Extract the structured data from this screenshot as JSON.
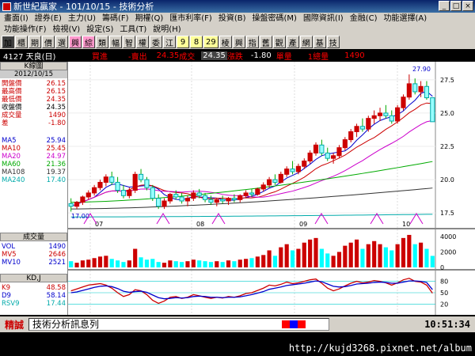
{
  "window": {
    "title": "新世紀贏家 - 101/10/15 - 技術分析"
  },
  "menu": {
    "row1": [
      "畫面(I)",
      "證券(E)",
      "主力(U)",
      "籌碼(F)",
      "期權(Q)",
      "匯市利率(F)",
      "投資(B)",
      "操盤密碼(M)",
      "國際資訊(I)",
      "金融(C)",
      "功能選擇(A)",
      "功能操作(F)"
    ],
    "row2": [
      "檢視(V)",
      "設定(S)",
      "工具(T)",
      "說明(H)"
    ]
  },
  "toolbar": {
    "buttons": [
      "加",
      "櫃",
      "期",
      "價",
      "選",
      "興",
      "綜",
      "類",
      "幅",
      "智",
      "權",
      "委",
      "江",
      "9",
      "8",
      "29",
      "棱",
      "興",
      "指",
      "舊",
      "觀",
      "產",
      "網",
      "基",
      "技"
    ]
  },
  "infobar": {
    "stock": "4127 天良(日)",
    "buy_label": "買進",
    "sell_label": "-賣出",
    "price": "24.35",
    "deal_label": "成交",
    "deal_value": "24.35",
    "change_label": "漲跌",
    "change_value": "-1.80",
    "vol_label": "單量",
    "lot": "1總量",
    "total": "1490"
  },
  "panel": {
    "title": "K線圖",
    "date": "2012/10/15",
    "ohlc": [
      {
        "label": "開盤價",
        "value": "26.15",
        "color": "#c00"
      },
      {
        "label": "最高價",
        "value": "26.15",
        "color": "#c00"
      },
      {
        "label": "最低價",
        "value": "24.35",
        "color": "#c00"
      },
      {
        "label": "收盤價",
        "value": "24.35",
        "color": "#000"
      },
      {
        "label": "成交量",
        "value": "1490",
        "color": "#c00"
      },
      {
        "label": "差",
        "value": "-1.80",
        "color": "#c00"
      }
    ],
    "ma": [
      {
        "label": "MA5",
        "value": "25.94",
        "color": "#00c"
      },
      {
        "label": "MA10",
        "value": "25.45",
        "color": "#c00"
      },
      {
        "label": "MA20",
        "value": "24.97",
        "color": "#c0c"
      },
      {
        "label": "MA60",
        "value": "21.36",
        "color": "#0a0"
      },
      {
        "label": "MA108",
        "value": "19.37",
        "color": "#333"
      },
      {
        "label": "MA240",
        "value": "17.40",
        "color": "#0aa"
      }
    ],
    "vol_title": "成交量",
    "vol": [
      {
        "label": "VOL",
        "value": "1490",
        "color": "#00c"
      },
      {
        "label": "MV5",
        "value": "2646",
        "color": "#c00"
      },
      {
        "label": "MV10",
        "value": "2521",
        "color": "#00c"
      }
    ],
    "kd_title": "KD,J",
    "kd": [
      {
        "label": "K9",
        "value": "48.58",
        "color": "#c00"
      },
      {
        "label": "D9",
        "value": "58.14",
        "color": "#00c"
      },
      {
        "label": "RSV9",
        "value": "17.44",
        "color": "#0aa"
      }
    ]
  },
  "chart_data": {
    "type": "candlestick",
    "x_months": [
      "07",
      "08",
      "09",
      "10"
    ],
    "price_axis": [
      "27.5",
      "25.0",
      "22.5",
      "20.0",
      "17.5"
    ],
    "ylim": [
      16.5,
      28.5
    ],
    "high_marker": "27.90",
    "low_marker": "17.00",
    "vol_axis": [
      "4000",
      "2000",
      "0"
    ],
    "kd_axis": [
      "80",
      "50",
      "20"
    ],
    "candles": [
      [
        18.2,
        18.6,
        17.6,
        18.0
      ],
      [
        18.0,
        18.4,
        17.8,
        18.3
      ],
      [
        18.3,
        18.8,
        18.1,
        18.7
      ],
      [
        18.7,
        19.2,
        18.5,
        19.0
      ],
      [
        19.0,
        19.6,
        18.8,
        19.4
      ],
      [
        19.4,
        20.0,
        19.2,
        19.8
      ],
      [
        19.8,
        20.4,
        19.5,
        20.2
      ],
      [
        20.2,
        20.6,
        19.6,
        19.8
      ],
      [
        19.8,
        20.2,
        19.0,
        19.2
      ],
      [
        19.2,
        19.6,
        18.6,
        18.8
      ],
      [
        18.8,
        19.4,
        18.6,
        19.2
      ],
      [
        19.2,
        20.6,
        19.0,
        20.4
      ],
      [
        20.4,
        20.8,
        19.8,
        20.0
      ],
      [
        20.0,
        20.2,
        19.2,
        19.4
      ],
      [
        19.4,
        19.6,
        18.4,
        18.6
      ],
      [
        18.6,
        18.9,
        17.8,
        18.0
      ],
      [
        18.0,
        18.6,
        17.8,
        18.4
      ],
      [
        18.4,
        19.0,
        18.2,
        18.9
      ],
      [
        18.9,
        19.2,
        18.5,
        18.7
      ],
      [
        18.7,
        19.0,
        18.2,
        18.4
      ],
      [
        18.4,
        18.8,
        18.0,
        18.6
      ],
      [
        18.6,
        19.2,
        18.4,
        19.0
      ],
      [
        19.0,
        19.3,
        18.6,
        18.8
      ],
      [
        18.8,
        19.0,
        18.3,
        18.5
      ],
      [
        18.5,
        18.8,
        18.1,
        18.3
      ],
      [
        18.3,
        18.6,
        18.0,
        18.5
      ],
      [
        18.5,
        18.8,
        18.2,
        18.4
      ],
      [
        18.4,
        18.7,
        18.1,
        18.6
      ],
      [
        18.6,
        18.9,
        18.3,
        18.5
      ],
      [
        18.5,
        18.9,
        18.3,
        18.8
      ],
      [
        18.8,
        19.2,
        18.6,
        19.0
      ],
      [
        19.0,
        19.3,
        18.7,
        18.9
      ],
      [
        18.9,
        19.4,
        18.8,
        19.3
      ],
      [
        19.3,
        19.8,
        19.1,
        19.6
      ],
      [
        19.6,
        20.2,
        19.4,
        20.0
      ],
      [
        20.0,
        20.4,
        19.6,
        19.8
      ],
      [
        19.8,
        20.6,
        19.7,
        20.4
      ],
      [
        20.4,
        21.0,
        20.2,
        20.8
      ],
      [
        20.8,
        21.4,
        20.4,
        20.6
      ],
      [
        20.6,
        21.2,
        20.4,
        21.0
      ],
      [
        21.0,
        21.6,
        20.8,
        21.4
      ],
      [
        21.4,
        22.2,
        21.2,
        22.0
      ],
      [
        22.0,
        22.8,
        21.8,
        22.6
      ],
      [
        22.6,
        23.0,
        21.8,
        22.0
      ],
      [
        22.0,
        22.4,
        21.4,
        21.6
      ],
      [
        21.6,
        22.0,
        21.2,
        21.8
      ],
      [
        21.8,
        22.6,
        21.6,
        22.4
      ],
      [
        22.4,
        23.2,
        22.2,
        23.0
      ],
      [
        23.0,
        23.8,
        22.8,
        23.6
      ],
      [
        23.6,
        24.2,
        23.2,
        24.0
      ],
      [
        24.0,
        24.6,
        23.6,
        23.8
      ],
      [
        23.8,
        24.8,
        23.6,
        24.6
      ],
      [
        24.6,
        25.2,
        24.2,
        24.8
      ],
      [
        24.8,
        25.4,
        24.4,
        25.0
      ],
      [
        25.0,
        25.6,
        24.6,
        24.8
      ],
      [
        24.8,
        25.2,
        24.2,
        24.4
      ],
      [
        24.4,
        25.6,
        24.2,
        25.4
      ],
      [
        25.4,
        26.4,
        25.2,
        26.2
      ],
      [
        26.2,
        27.9,
        26.0,
        27.2
      ],
      [
        27.2,
        27.6,
        26.4,
        26.6
      ],
      [
        26.6,
        27.4,
        26.2,
        27.0
      ],
      [
        27.0,
        27.4,
        26.0,
        26.15
      ],
      [
        26.15,
        26.15,
        24.35,
        24.35
      ]
    ],
    "kd_k": [
      55,
      60,
      65,
      70,
      72,
      74,
      70,
      62,
      50,
      40,
      45,
      58,
      55,
      45,
      30,
      22,
      28,
      38,
      40,
      35,
      38,
      45,
      42,
      38,
      35,
      38,
      36,
      40,
      38,
      42,
      48,
      50,
      56,
      62,
      70,
      68,
      72,
      78,
      74,
      76,
      80,
      84,
      86,
      75,
      62,
      55,
      60,
      68,
      75,
      80,
      76,
      78,
      82,
      80,
      76,
      70,
      76,
      84,
      88,
      80,
      78,
      70,
      48.58
    ],
    "kd_d": [
      50,
      52,
      56,
      60,
      64,
      67,
      68,
      66,
      61,
      54,
      51,
      53,
      54,
      51,
      44,
      37,
      34,
      35,
      37,
      36,
      37,
      40,
      41,
      40,
      38,
      38,
      37,
      38,
      38,
      39,
      42,
      45,
      49,
      53,
      59,
      62,
      65,
      69,
      71,
      73,
      75,
      78,
      81,
      79,
      73,
      67,
      65,
      66,
      69,
      73,
      74,
      75,
      77,
      78,
      77,
      75,
      75,
      78,
      81,
      81,
      80,
      77,
      58.14
    ],
    "vol": [
      800,
      600,
      900,
      1000,
      1200,
      1400,
      1500,
      1100,
      900,
      700,
      900,
      2400,
      1300,
      1000,
      1100,
      700,
      600,
      900,
      800,
      700,
      800,
      1000,
      900,
      800,
      700,
      800,
      700,
      900,
      800,
      1000,
      1100,
      1200,
      1400,
      1600,
      2200,
      1500,
      2600,
      3000,
      2200,
      2400,
      3200,
      3600,
      3800,
      2400,
      1800,
      1500,
      2000,
      2800,
      3200,
      3600,
      2400,
      3000,
      3400,
      3000,
      2600,
      2200,
      3000,
      3800,
      4200,
      3000,
      3200,
      2400,
      1490
    ]
  },
  "status": {
    "left_label": "精誠",
    "message": "技術分析訊息列",
    "time": "10:51:34"
  },
  "footer": {
    "url": "http://kujd3268.pixnet.net/album"
  }
}
